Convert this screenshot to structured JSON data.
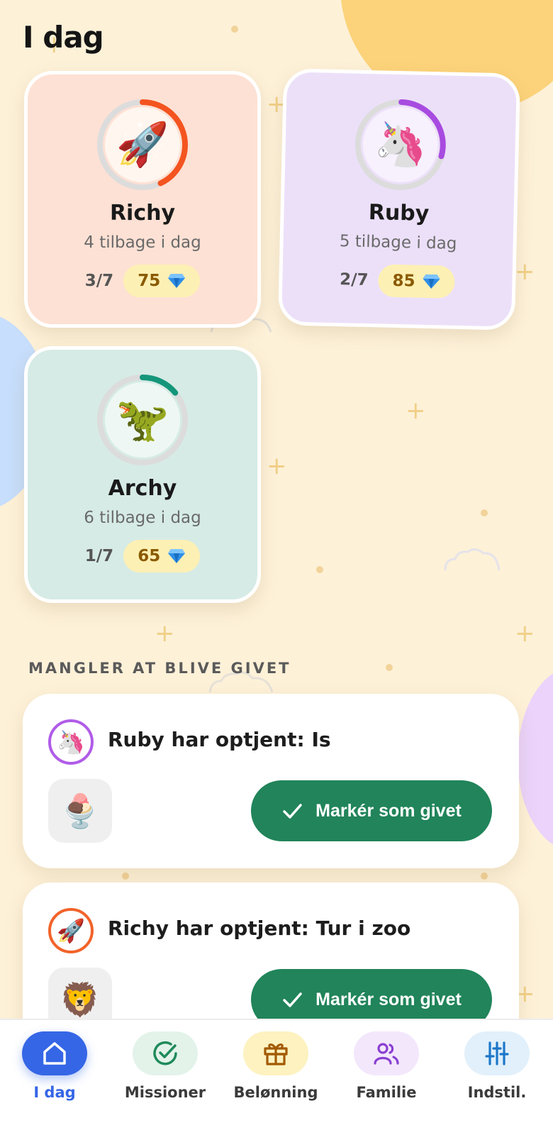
{
  "screen": {
    "title": "I dag"
  },
  "kids": [
    {
      "name": "Richy",
      "subtitle": "4 tilbage i dag",
      "progress_text": "3/7",
      "progress_fraction": 0.43,
      "gems": "75",
      "avatar": "rocket-icon",
      "emoji": "🚀",
      "ring_color": "#f4541f"
    },
    {
      "name": "Ruby",
      "subtitle": "5 tilbage i dag",
      "progress_text": "2/7",
      "progress_fraction": 0.29,
      "gems": "85",
      "avatar": "unicorn-icon",
      "emoji": "🦄",
      "ring_color": "#a84be0"
    },
    {
      "name": "Archy",
      "subtitle": "6 tilbage i dag",
      "progress_text": "1/7",
      "progress_fraction": 0.14,
      "gems": "65",
      "avatar": "dinosaur-icon",
      "emoji": "🦖",
      "ring_color": "#14967a"
    }
  ],
  "section": {
    "label": "MANGLER AT BLIVE GIVET"
  },
  "rewards": [
    {
      "title": "Ruby har optjent: Is",
      "avatar_emoji": "🦄",
      "thumb_emoji": "🍨",
      "thumb_icon": "ice-cream-icon",
      "button_label": "Markér som givet"
    },
    {
      "title": "Richy har optjent: Tur i zoo",
      "avatar_emoji": "🚀",
      "thumb_emoji": "🦁",
      "thumb_icon": "lion-icon",
      "button_label": "Markér som givet"
    }
  ],
  "tabs": [
    {
      "label": "I dag",
      "icon": "home-icon",
      "active": true
    },
    {
      "label": "Missioner",
      "icon": "check-circle-icon",
      "active": false
    },
    {
      "label": "Belønning",
      "icon": "gift-icon",
      "active": false
    },
    {
      "label": "Familie",
      "icon": "people-icon",
      "active": false
    },
    {
      "label": "Indstil.",
      "icon": "sliders-icon",
      "active": false
    }
  ],
  "colors": {
    "accent": "#3566e6",
    "confirm": "#21845a",
    "background": "#fdf1d8"
  }
}
